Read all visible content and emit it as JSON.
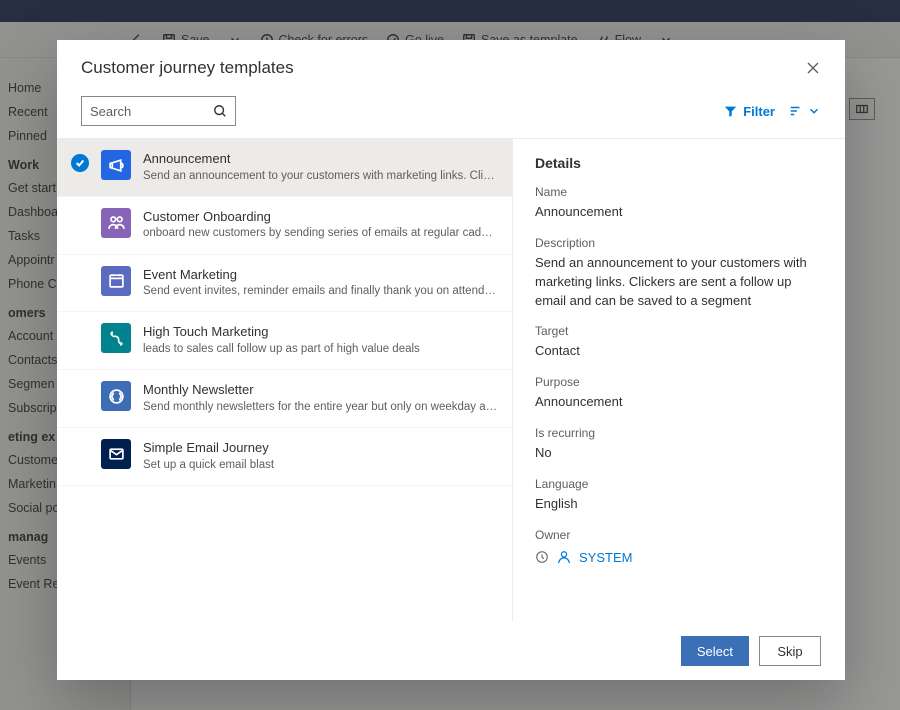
{
  "background": {
    "toolbar": {
      "save": "Save",
      "check": "Check for errors",
      "golive": "Go live",
      "saveas": "Save as template",
      "flow": "Flow"
    },
    "sidebar": {
      "group1": [
        "Home",
        "Recent",
        "Pinned"
      ],
      "group2_header": "Work",
      "group2": [
        "Get start",
        "Dashboa",
        "Tasks",
        "Appointr",
        "Phone C"
      ],
      "group3_header": "omers",
      "group3": [
        "Account",
        "Contacts",
        "Segmen",
        "Subscrip"
      ],
      "group4_header": "eting ex",
      "group4": [
        "Custome",
        "Marketin",
        "Social po"
      ],
      "group5_header": "manag",
      "group5": [
        "Events",
        "Event Registrations"
      ]
    }
  },
  "modal": {
    "title": "Customer journey templates",
    "search_placeholder": "Search",
    "filter_label": "Filter",
    "templates": [
      {
        "name": "Announcement",
        "desc": "Send an announcement to your customers with marketing links. Clickers are sent a...",
        "icon": "announcement",
        "selected": true
      },
      {
        "name": "Customer Onboarding",
        "desc": "onboard new customers by sending series of emails at regular cadence",
        "icon": "onboarding",
        "selected": false
      },
      {
        "name": "Event Marketing",
        "desc": "Send event invites, reminder emails and finally thank you on attending",
        "icon": "event",
        "selected": false
      },
      {
        "name": "High Touch Marketing",
        "desc": "leads to sales call follow up as part of high value deals",
        "icon": "hightouch",
        "selected": false
      },
      {
        "name": "Monthly Newsletter",
        "desc": "Send monthly newsletters for the entire year but only on weekday afternoons",
        "icon": "newsletter",
        "selected": false
      },
      {
        "name": "Simple Email Journey",
        "desc": "Set up a quick email blast",
        "icon": "email",
        "selected": false
      }
    ],
    "details": {
      "header": "Details",
      "name_label": "Name",
      "name": "Announcement",
      "description_label": "Description",
      "description": "Send an announcement to your customers with marketing links. Clickers are sent a follow up email and can be saved to a segment",
      "target_label": "Target",
      "target": "Contact",
      "purpose_label": "Purpose",
      "purpose": "Announcement",
      "recurring_label": "Is recurring",
      "recurring": "No",
      "language_label": "Language",
      "language": "English",
      "owner_label": "Owner",
      "owner": "SYSTEM"
    },
    "buttons": {
      "select": "Select",
      "skip": "Skip"
    }
  }
}
